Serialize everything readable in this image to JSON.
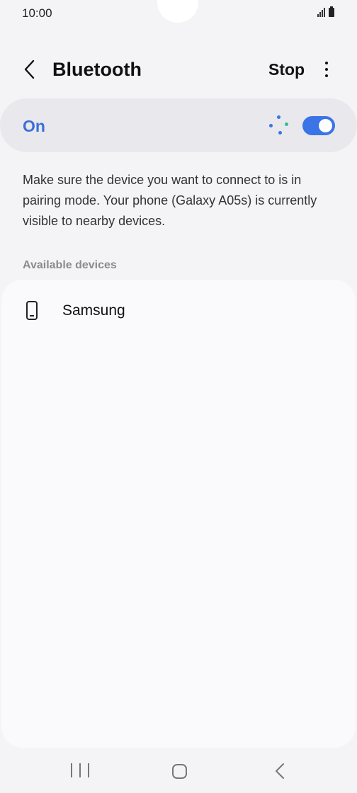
{
  "status_bar": {
    "time": "10:00",
    "icons": [
      "signal-icon",
      "battery-icon"
    ]
  },
  "header": {
    "back_icon": "chevron-left-icon",
    "title": "Bluetooth",
    "stop_label": "Stop",
    "more_icon": "more-vertical-icon"
  },
  "toggle": {
    "label": "On",
    "state": "on",
    "scanning": true,
    "accent_color": "#3b74e6",
    "label_color": "#3b6fd8"
  },
  "description": "Make sure the device you want to connect to is in pairing mode. Your phone (Galaxy A05s) is currently visible to nearby devices.",
  "available_devices": {
    "label": "Available devices",
    "items": [
      {
        "name": "Samsung",
        "icon": "phone-icon"
      }
    ]
  },
  "nav_bar": {
    "icons": [
      "recents-icon",
      "home-icon",
      "back-icon"
    ]
  }
}
